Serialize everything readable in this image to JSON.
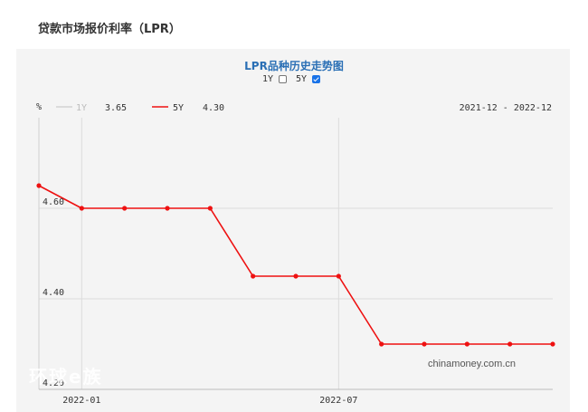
{
  "page": {
    "title": "贷款市场报价利率（LPR）"
  },
  "watermarks": {
    "site": "chinamoney.com.cn",
    "corner": "环球e族"
  },
  "toggle": {
    "items": [
      {
        "label": "1Y",
        "checked": false
      },
      {
        "label": "5Y",
        "checked": true
      }
    ]
  },
  "legend": {
    "items": [
      {
        "label": "1Y",
        "value": "3.65",
        "color": "#cccccc"
      },
      {
        "label": "5Y",
        "value": "4.30",
        "color": "#ee1111"
      }
    ]
  },
  "chart_data": {
    "type": "line",
    "title": "LPR品种历史走势图",
    "ylabel": "%",
    "date_range": "2021-12 - 2022-12",
    "ylim": [
      4.2,
      4.8
    ],
    "yticks": [
      "4.20",
      "4.40",
      "4.60"
    ],
    "xticks": [
      "2022-01",
      "2022-07"
    ],
    "grid": true,
    "legend_position": "top-left",
    "series": [
      {
        "name": "5Y",
        "color": "#ee1111",
        "x": [
          "2021-12",
          "2022-01",
          "2022-02",
          "2022-03",
          "2022-04",
          "2022-05",
          "2022-06",
          "2022-07",
          "2022-08",
          "2022-09",
          "2022-10",
          "2022-11",
          "2022-12"
        ],
        "values": [
          4.65,
          4.6,
          4.6,
          4.6,
          4.6,
          4.45,
          4.45,
          4.45,
          4.3,
          4.3,
          4.3,
          4.3,
          4.3
        ]
      }
    ]
  }
}
